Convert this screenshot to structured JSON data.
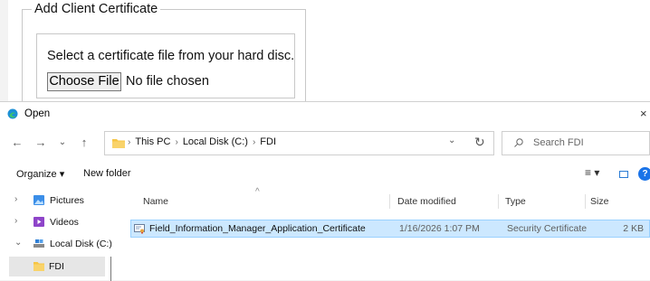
{
  "webpage": {
    "legend": "Add Client Certificate",
    "instruction": "Select a certificate file from your hard disc.",
    "choose_button": "Choose File",
    "file_status": "No file chosen"
  },
  "dialog": {
    "title": "Open",
    "close": "×",
    "nav": {
      "back": "←",
      "forward": "→",
      "recent": "⌄",
      "up": "↑"
    },
    "breadcrumbs": [
      "This PC",
      "Local Disk (C:)",
      "FDI"
    ],
    "search_placeholder": "Search FDI",
    "toolbar": {
      "organize": "Organize ▾",
      "new_folder": "New folder",
      "view": "≡ ▾",
      "help": "?"
    },
    "nav_pane": [
      {
        "label": "Pictures",
        "icon": "pictures-icon",
        "chevron": "›"
      },
      {
        "label": "Videos",
        "icon": "videos-icon",
        "chevron": "›"
      },
      {
        "label": "Local Disk (C:)",
        "icon": "drive-icon",
        "chevron": "⌄"
      },
      {
        "label": "FDI",
        "icon": "folder-icon",
        "chevron": ""
      }
    ],
    "columns": [
      "Name",
      "Date modified",
      "Type",
      "Size"
    ],
    "files": [
      {
        "name": "Field_Information_Manager_Application_Certificate",
        "date": "1/16/2026 1:07 PM",
        "type": "Security Certificate",
        "size": "2 KB",
        "icon": "certificate-file-icon"
      }
    ],
    "colors": {
      "selection_bg": "#cce8ff",
      "selection_border": "#99d1ff",
      "accent": "#1a73e8",
      "folder": "#f6c544"
    }
  }
}
